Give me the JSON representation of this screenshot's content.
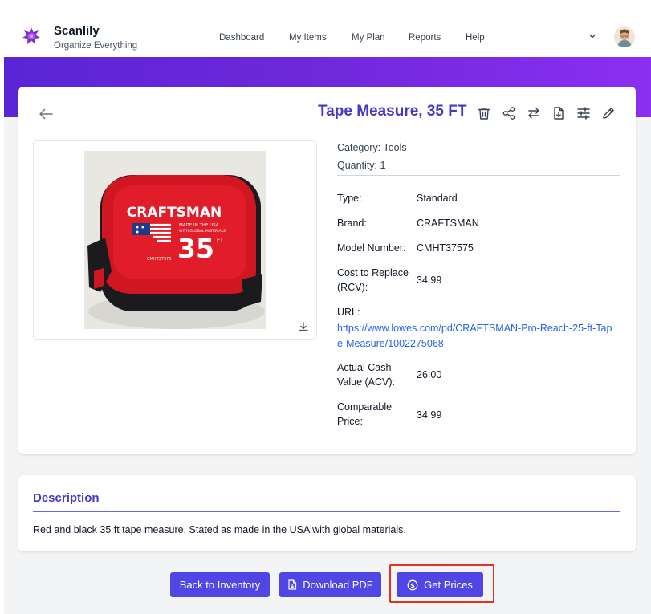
{
  "brand": {
    "name": "Scanlily",
    "tagline": "Organize Everything"
  },
  "nav": {
    "items": [
      {
        "label": "Dashboard"
      },
      {
        "label": "My Items"
      },
      {
        "label": "My Plan"
      },
      {
        "label": "Reports"
      },
      {
        "label": "Help"
      }
    ],
    "menu_icon": "chevron-down-icon",
    "avatar_icon": "user-avatar"
  },
  "item": {
    "title": "Tape Measure, 35 FT",
    "category": "Category: Tools",
    "quantity": "Quantity: 1",
    "fields": {
      "type": {
        "label": "Type:",
        "value": "Standard"
      },
      "brand": {
        "label": "Brand:",
        "value": "CRAFTSMAN"
      },
      "model": {
        "label": "Model Number:",
        "value": "CMHT37575"
      },
      "rcv": {
        "label": "Cost to Replace (RCV):",
        "value": "34.99"
      },
      "url": {
        "label": "URL:",
        "value": "https://www.lowes.com/pd/CRAFTSMAN-Pro-Reach-25-ft-Tape-Measure/1002275068"
      },
      "acv": {
        "label": "Actual Cash Value (ACV):",
        "value": "26.00"
      },
      "comparable": {
        "label": "Comparable Price:",
        "value": "34.99"
      }
    },
    "photo": {
      "brand_text": "CRAFTSMAN",
      "made_in_text": "MADE IN THE USA",
      "global_text": "WITH GLOBAL MATERIALS",
      "size_text": "35",
      "unit_text": "FT",
      "model_text": "CMHT37575"
    }
  },
  "toolbar": {
    "icons": [
      "trash-icon",
      "share-icon",
      "transfer-icon",
      "file-download-icon",
      "adjust-icon",
      "edit-icon"
    ]
  },
  "description": {
    "title": "Description",
    "text": "Red and black 35 ft tape measure. Stated as made in the USA with global materials."
  },
  "actions": {
    "back_label": "Back to Inventory",
    "pdf_label": "Download PDF",
    "prices_label": "Get Prices"
  },
  "colors": {
    "accent": "#4f46e5",
    "title": "#4338ca",
    "link": "#2563eb",
    "banner_start": "#5a25d6",
    "banner_end": "#8b2ff0",
    "highlight": "#e0321c"
  }
}
